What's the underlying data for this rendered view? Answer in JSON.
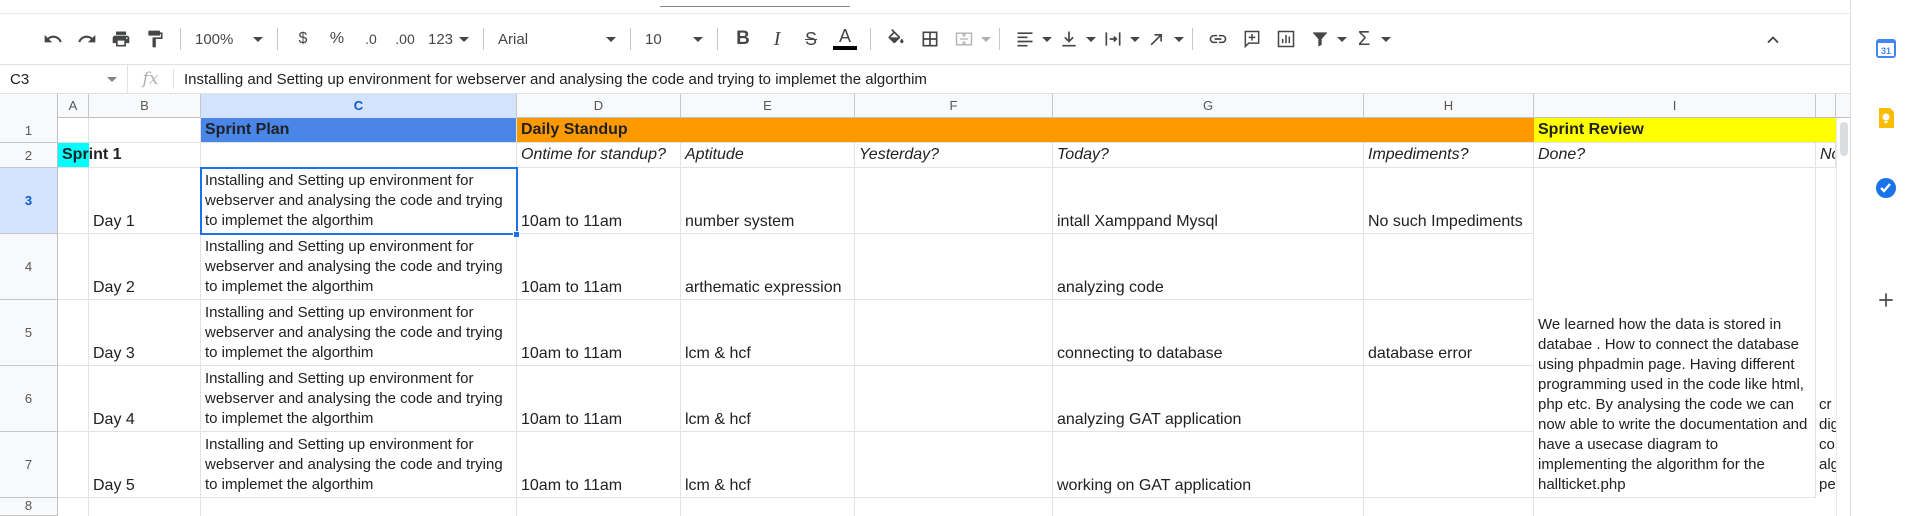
{
  "toolbar": {
    "zoom": "100%",
    "currency": "$",
    "percent": "%",
    "decrease_decimal": ".0",
    "increase_decimal": ".00",
    "more_formats": "123",
    "font": "Arial",
    "font_size": "10",
    "bold": "B",
    "italic": "I",
    "strikethrough": "S",
    "text_color": "A",
    "sum": "Σ"
  },
  "formula_bar": {
    "cell_ref": "C3",
    "fx": "fx",
    "content": "Installing and Setting up environment for webserver and analysing the code and trying to implemet the algorthim"
  },
  "columns": [
    {
      "id": "A",
      "selected": false
    },
    {
      "id": "B",
      "selected": false
    },
    {
      "id": "C",
      "selected": true
    },
    {
      "id": "D",
      "selected": false
    },
    {
      "id": "E",
      "selected": false
    },
    {
      "id": "F",
      "selected": false
    },
    {
      "id": "G",
      "selected": false
    },
    {
      "id": "H",
      "selected": false
    },
    {
      "id": "I",
      "selected": false
    }
  ],
  "rows": [
    "1",
    "2",
    "3",
    "4",
    "5",
    "6",
    "7",
    "8"
  ],
  "header_row": {
    "sprint_plan": "Sprint Plan",
    "daily_standup": "Daily Standup",
    "sprint_review": "Sprint Review"
  },
  "subheader_row": {
    "sprint": "Sprint 1",
    "ontime": "Ontime for standup?",
    "aptitude": "Aptitude",
    "yesterday": "Yesterday?",
    "today": "Today?",
    "impediments": "Impediments?",
    "done": "Done?",
    "next_partial": "Nc"
  },
  "days": [
    {
      "day": "Day 1",
      "plan": "Installing and Setting up environment for webserver and analysing the code and trying to implemet the algorthim",
      "time": "10am to 11am",
      "aptitude": "number system",
      "yesterday": "",
      "today": "intall Xamppand Mysql",
      "impediments": "No such Impediments"
    },
    {
      "day": "Day 2",
      "plan": "Installing and Setting up environment for webserver and analysing the code and trying to implemet the algorthim",
      "time": "10am to 11am",
      "aptitude": "arthematic expression",
      "yesterday": "",
      "today": "analyzing code",
      "impediments": ""
    },
    {
      "day": "Day 3",
      "plan": "Installing and Setting up environment for webserver and analysing the code and trying to implemet the algorthim",
      "time": "10am to 11am",
      "aptitude": "lcm & hcf",
      "yesterday": "",
      "today": "connecting to database",
      "impediments": "database error"
    },
    {
      "day": "Day 4",
      "plan": "Installing and Setting up environment for webserver and analysing the code and trying to implemet the algorthim",
      "time": "10am to 11am",
      "aptitude": "lcm & hcf",
      "yesterday": "",
      "today": "analyzing GAT application",
      "impediments": ""
    },
    {
      "day": "Day 5",
      "plan": "Installing and Setting up environment for webserver and analysing the code and trying to implemet the algorthim",
      "time": "10am to 11am",
      "aptitude": "lcm & hcf",
      "yesterday": "",
      "today": "working on GAT application",
      "impediments": ""
    }
  ],
  "done_text": "We learned  how the data is stored in databae . How to connect the database using phpadmin page. Having different programming used in the code like html, php etc. By analysing the code we can now able to write the documentation and have a usecase diagram to implementing the algorithm for the hallticket.php",
  "partial_col_text": [
    "cr",
    "dig",
    "co",
    "alg",
    "pe"
  ],
  "colors": {
    "sprint_plan_bg": "#4a86e8",
    "daily_standup_bg": "#ff9900",
    "sprint_review_bg": "#ffff00",
    "sprint1_bg": "#00ffff",
    "selection": "#1a73e8"
  },
  "side_panel": {
    "calendar_label": "31"
  }
}
